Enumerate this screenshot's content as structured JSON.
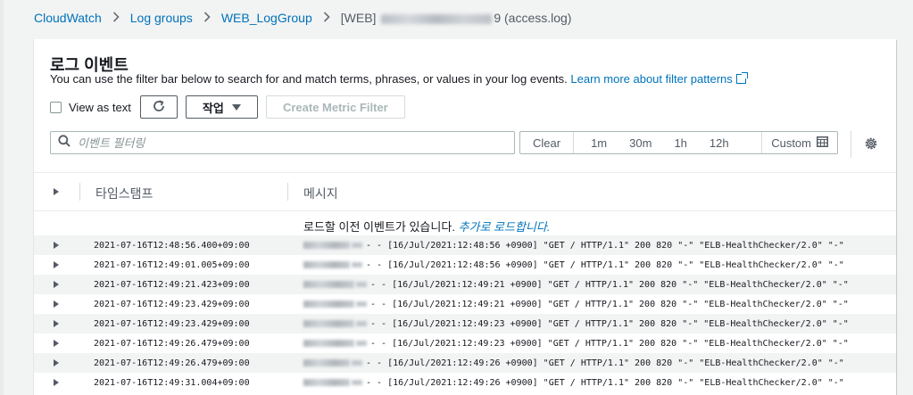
{
  "breadcrumb": {
    "items": [
      "CloudWatch",
      "Log groups",
      "WEB_LogGroup"
    ],
    "current_prefix": "[WEB]",
    "current_suffix": "9 (access.log)"
  },
  "panel": {
    "title": "로그 이벤트",
    "description": "You can use the filter bar below to search for and match terms, phrases, or values in your log events.",
    "learn_more": "Learn more about filter patterns"
  },
  "toolbar": {
    "view_as_text": "View as text",
    "action_label": "작업",
    "create_metric_filter": "Create Metric Filter"
  },
  "search": {
    "placeholder": "이벤트 필터링"
  },
  "time_range": {
    "clear": "Clear",
    "options": [
      "1m",
      "30m",
      "1h",
      "12h"
    ],
    "custom": "Custom"
  },
  "table": {
    "col_timestamp": "타임스탬프",
    "col_message": "메시지",
    "load_more_text": "로드할 이전 이벤트가 있습니다.",
    "load_more_link": "추가로 로드합니다."
  },
  "rows": [
    {
      "timestamp": "2021-07-16T12:48:56.400+09:00",
      "message": "- - [16/Jul/2021:12:48:56 +0900] \"GET / HTTP/1.1\" 200 820 \"-\" \"ELB-HealthChecker/2.0\" \"-\""
    },
    {
      "timestamp": "2021-07-16T12:49:01.005+09:00",
      "message": "- - [16/Jul/2021:12:48:56 +0900] \"GET / HTTP/1.1\" 200 820 \"-\" \"ELB-HealthChecker/2.0\" \"-\""
    },
    {
      "timestamp": "2021-07-16T12:49:21.423+09:00",
      "message": "- - [16/Jul/2021:12:49:21 +0900] \"GET / HTTP/1.1\" 200 820 \"-\" \"ELB-HealthChecker/2.0\" \"-\""
    },
    {
      "timestamp": "2021-07-16T12:49:23.429+09:00",
      "message": "- - [16/Jul/2021:12:49:21 +0900] \"GET / HTTP/1.1\" 200 820 \"-\" \"ELB-HealthChecker/2.0\" \"-\""
    },
    {
      "timestamp": "2021-07-16T12:49:23.429+09:00",
      "message": "- - [16/Jul/2021:12:49:23 +0900] \"GET / HTTP/1.1\" 200 820 \"-\" \"ELB-HealthChecker/2.0\" \"-\""
    },
    {
      "timestamp": "2021-07-16T12:49:26.479+09:00",
      "message": "- - [16/Jul/2021:12:49:23 +0900] \"GET / HTTP/1.1\" 200 820 \"-\" \"ELB-HealthChecker/2.0\" \"-\""
    },
    {
      "timestamp": "2021-07-16T12:49:26.479+09:00",
      "message": "- - [16/Jul/2021:12:49:26 +0900] \"GET / HTTP/1.1\" 200 820 \"-\" \"ELB-HealthChecker/2.0\" \"-\""
    },
    {
      "timestamp": "2021-07-16T12:49:31.004+09:00",
      "message": "- - [16/Jul/2021:12:49:26 +0900] \"GET / HTTP/1.1\" 200 820 \"-\" \"ELB-HealthChecker/2.0\" \"-\""
    }
  ],
  "colors": {
    "link": "#0073bb",
    "row_alt": "#f2f3f3",
    "page_bg": "#f2f3f3"
  },
  "icons": [
    "chevron-right-icon",
    "external-link-icon",
    "refresh-icon",
    "caret-down-icon",
    "search-icon",
    "calendar-icon",
    "gear-icon",
    "expand-caret-icon"
  ]
}
